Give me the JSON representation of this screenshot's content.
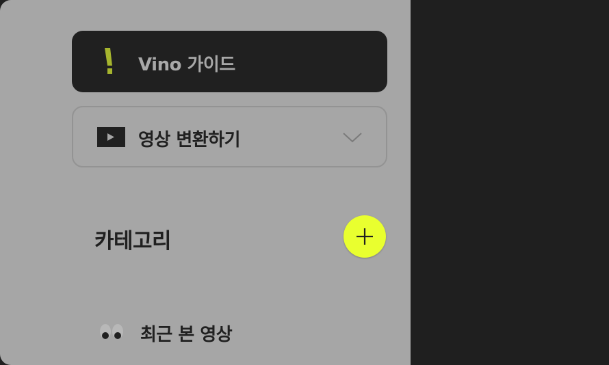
{
  "sidebar": {
    "guide_button": {
      "label": "Vino 가이드",
      "icon": "exclamation-icon",
      "icon_color": "#a6b52e"
    },
    "video_convert": {
      "label": "영상 변환하기",
      "icon": "play-icon",
      "chevron": "chevron-down-icon"
    },
    "category": {
      "title": "카테고리",
      "add_icon": "plus-icon",
      "add_color": "#e9ff2f"
    },
    "recent": {
      "label": "최근 본 영상",
      "icon": "eyes-icon"
    }
  },
  "colors": {
    "sidebar_bg": "#a6a6a6",
    "dark_bg": "#1f1f1f",
    "accent": "#e9ff2f"
  }
}
